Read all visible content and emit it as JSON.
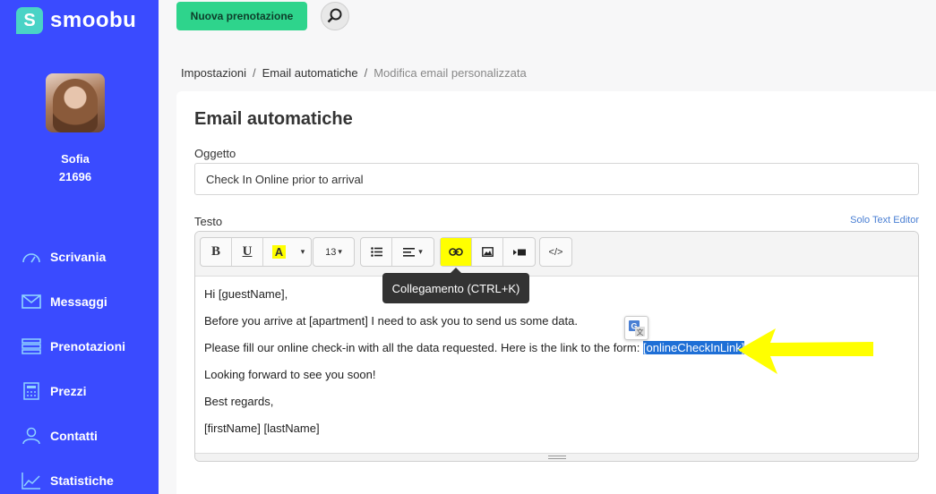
{
  "brand": {
    "name": "smoobu",
    "mark": "S",
    "icon": "logo-icon"
  },
  "user": {
    "name": "Sofia",
    "id": "21696"
  },
  "nav": [
    {
      "label": "Scrivania",
      "icon": "dashboard-icon"
    },
    {
      "label": "Messaggi",
      "icon": "envelope-icon"
    },
    {
      "label": "Prenotazioni",
      "icon": "list-icon"
    },
    {
      "label": "Prezzi",
      "icon": "calculator-icon"
    },
    {
      "label": "Contatti",
      "icon": "contacts-icon"
    },
    {
      "label": "Statistiche",
      "icon": "chart-icon"
    }
  ],
  "topbar": {
    "new_booking": "Nuova prenotazione",
    "search_icon": "search-icon"
  },
  "breadcrumb": {
    "items": [
      "Impostazioni",
      "Email automatiche"
    ],
    "current": "Modifica email personalizzata",
    "separator": "/"
  },
  "page": {
    "title": "Email automatiche"
  },
  "form": {
    "subject_label": "Oggetto",
    "subject_value": "Check In Online prior to arrival",
    "text_label": "Testo",
    "text_editor_link": "Solo Text Editor"
  },
  "toolbar": {
    "bold": "B",
    "underline": "U",
    "highlight": "A",
    "font_size": "13",
    "code": "</>",
    "tooltip": "Collegamento (CTRL+K)",
    "active_color": "#ffff00"
  },
  "body": {
    "line1": "Hi [guestName],",
    "line2": "Before you arrive at [apartment] I need to ask you to send us some data.",
    "line3_prefix": "Please fill our online check-in with all the data requested. Here is the link to the form: ",
    "line3_selected": "[onlineCheckInLink]",
    "line4": "Looking forward to see you soon!",
    "line5": "Best regards,",
    "line6": "[firstName] [lastName]"
  },
  "colors": {
    "sidebar": "#3a4bff",
    "accent_green": "#2ed48c",
    "selection": "#1e6fd6",
    "annotation": "#ffff00"
  }
}
